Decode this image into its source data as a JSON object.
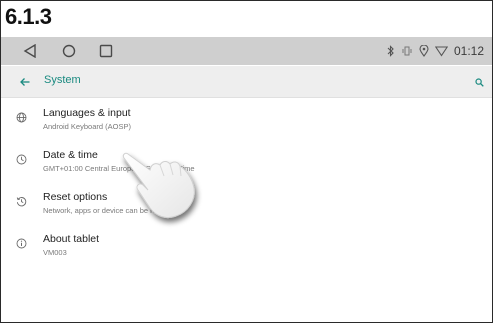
{
  "step_label": "6.1.3",
  "status_bar": {
    "nav": [
      "back-triangle",
      "home-circle",
      "recents-square"
    ],
    "icons": [
      "bluetooth-icon",
      "vibrate-icon",
      "location-icon",
      "wifi-icon"
    ],
    "time": "01:12"
  },
  "app_bar": {
    "title": "System",
    "accent_color": "#1a8a80"
  },
  "items": [
    {
      "title": "Languages & input",
      "subtitle": "Android Keyboard (AOSP)",
      "icon": "globe-icon"
    },
    {
      "title": "Date & time",
      "subtitle": "GMT+01:00 Central European Standard Time",
      "icon": "clock-icon"
    },
    {
      "title": "Reset options",
      "subtitle": "Network, apps or device can be reset",
      "icon": "history-icon"
    },
    {
      "title": "About tablet",
      "subtitle": "VM003",
      "icon": "info-icon"
    }
  ]
}
